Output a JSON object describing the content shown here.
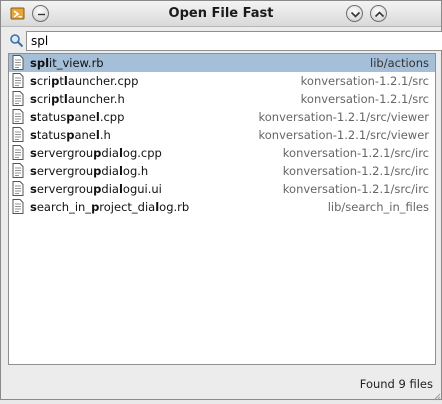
{
  "window": {
    "title": "Open File Fast"
  },
  "search": {
    "value": "spl"
  },
  "results": [
    {
      "name": "split_view.rb",
      "path": "lib/actions",
      "selected": true,
      "segs": [
        {
          "t": "spl",
          "m": true
        },
        {
          "t": "it_view.rb",
          "m": false
        }
      ]
    },
    {
      "name": "scriptlauncher.cpp",
      "path": "konversation-1.2.1/src",
      "selected": false,
      "segs": [
        {
          "t": "s",
          "m": true
        },
        {
          "t": "cri",
          "m": false
        },
        {
          "t": "p",
          "m": true
        },
        {
          "t": "t",
          "m": false
        },
        {
          "t": "l",
          "m": true
        },
        {
          "t": "auncher.cpp",
          "m": false
        }
      ]
    },
    {
      "name": "scriptlauncher.h",
      "path": "konversation-1.2.1/src",
      "selected": false,
      "segs": [
        {
          "t": "s",
          "m": true
        },
        {
          "t": "cri",
          "m": false
        },
        {
          "t": "p",
          "m": true
        },
        {
          "t": "t",
          "m": false
        },
        {
          "t": "l",
          "m": true
        },
        {
          "t": "auncher.h",
          "m": false
        }
      ]
    },
    {
      "name": "statuspanel.cpp",
      "path": "konversation-1.2.1/src/viewer",
      "selected": false,
      "segs": [
        {
          "t": "s",
          "m": true
        },
        {
          "t": "tatus",
          "m": false
        },
        {
          "t": "p",
          "m": true
        },
        {
          "t": "ane",
          "m": false
        },
        {
          "t": "l",
          "m": true
        },
        {
          "t": ".cpp",
          "m": false
        }
      ]
    },
    {
      "name": "statuspanel.h",
      "path": "konversation-1.2.1/src/viewer",
      "selected": false,
      "segs": [
        {
          "t": "s",
          "m": true
        },
        {
          "t": "tatus",
          "m": false
        },
        {
          "t": "p",
          "m": true
        },
        {
          "t": "ane",
          "m": false
        },
        {
          "t": "l",
          "m": true
        },
        {
          "t": ".h",
          "m": false
        }
      ]
    },
    {
      "name": "servergroupdialog.cpp",
      "path": "konversation-1.2.1/src/irc",
      "selected": false,
      "segs": [
        {
          "t": "s",
          "m": true
        },
        {
          "t": "ervergrou",
          "m": false
        },
        {
          "t": "p",
          "m": true
        },
        {
          "t": "dia",
          "m": false
        },
        {
          "t": "l",
          "m": true
        },
        {
          "t": "og.cpp",
          "m": false
        }
      ]
    },
    {
      "name": "servergroupdialog.h",
      "path": "konversation-1.2.1/src/irc",
      "selected": false,
      "segs": [
        {
          "t": "s",
          "m": true
        },
        {
          "t": "ervergrou",
          "m": false
        },
        {
          "t": "p",
          "m": true
        },
        {
          "t": "dia",
          "m": false
        },
        {
          "t": "l",
          "m": true
        },
        {
          "t": "og.h",
          "m": false
        }
      ]
    },
    {
      "name": "servergroupdialogui.ui",
      "path": "konversation-1.2.1/src/irc",
      "selected": false,
      "segs": [
        {
          "t": "s",
          "m": true
        },
        {
          "t": "ervergrou",
          "m": false
        },
        {
          "t": "p",
          "m": true
        },
        {
          "t": "dia",
          "m": false
        },
        {
          "t": "l",
          "m": true
        },
        {
          "t": "ogui.ui",
          "m": false
        }
      ]
    },
    {
      "name": "search_in_project_dialog.rb",
      "path": "lib/search_in_files",
      "selected": false,
      "segs": [
        {
          "t": "s",
          "m": true
        },
        {
          "t": "earch_in_",
          "m": false
        },
        {
          "t": "p",
          "m": true
        },
        {
          "t": "roject_dia",
          "m": false
        },
        {
          "t": "l",
          "m": true
        },
        {
          "t": "og.rb",
          "m": false
        }
      ]
    }
  ],
  "status": {
    "text": "Found 9 files"
  },
  "colors": {
    "selection": "#a5bfd9",
    "path_text": "#666666"
  },
  "icons": {
    "app": "app-icon",
    "titlebar": [
      "pin-icon",
      "minimize-icon",
      "maximize-icon"
    ],
    "search": "search-icon",
    "file": "document-icon"
  }
}
